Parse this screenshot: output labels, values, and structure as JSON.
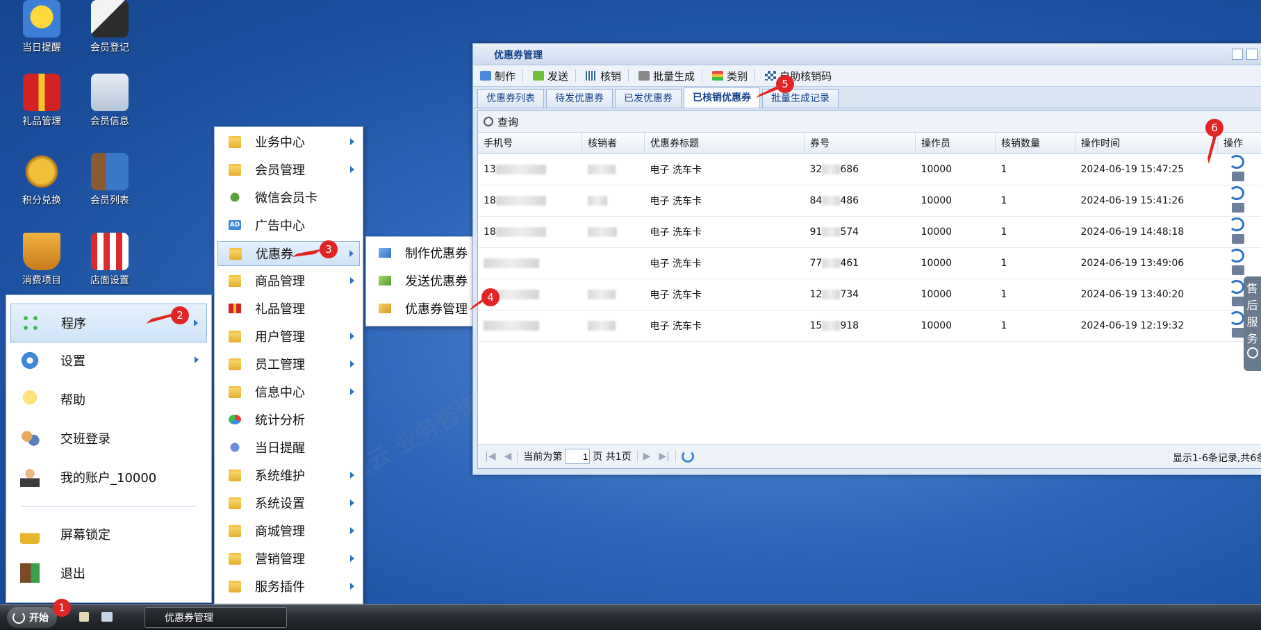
{
  "desktop": {
    "icons": [
      {
        "label": "当日提醒",
        "icon": "smiley-reminder-icon"
      },
      {
        "label": "会员登记",
        "icon": "member-register-icon"
      },
      {
        "label": "礼品管理",
        "icon": "gift-icon"
      },
      {
        "label": "会员信息",
        "icon": "member-info-icon"
      },
      {
        "label": "积分兑换",
        "icon": "points-exchange-icon"
      },
      {
        "label": "会员列表",
        "icon": "member-list-icon"
      },
      {
        "label": "消费项目",
        "icon": "basket-icon"
      },
      {
        "label": "店面设置",
        "icon": "store-icon"
      }
    ]
  },
  "start_menu": {
    "items": [
      {
        "label": "程序",
        "icon": "programs-icon"
      },
      {
        "label": "设置",
        "icon": "gear-icon"
      },
      {
        "label": "帮助",
        "icon": "lightbulb-icon"
      },
      {
        "label": "交班登录",
        "icon": "users-icon"
      },
      {
        "label": "我的账户_10000",
        "icon": "account-icon"
      },
      {
        "label": "屏幕锁定",
        "icon": "lock-icon"
      },
      {
        "label": "退出",
        "icon": "exit-icon"
      }
    ]
  },
  "programs_menu": {
    "items": [
      {
        "label": "业务中心"
      },
      {
        "label": "会员管理"
      },
      {
        "label": "微信会员卡"
      },
      {
        "label": "广告中心"
      },
      {
        "label": "优惠券"
      },
      {
        "label": "商品管理"
      },
      {
        "label": "礼品管理"
      },
      {
        "label": "用户管理"
      },
      {
        "label": "员工管理"
      },
      {
        "label": "信息中心"
      },
      {
        "label": "统计分析"
      },
      {
        "label": "当日提醒"
      },
      {
        "label": "系统维护"
      },
      {
        "label": "系统设置"
      },
      {
        "label": "商城管理"
      },
      {
        "label": "营销管理"
      },
      {
        "label": "服务插件"
      }
    ],
    "ad_label": "AD"
  },
  "coupon_menu": {
    "items": [
      {
        "label": "制作优惠券"
      },
      {
        "label": "发送优惠券"
      },
      {
        "label": "优惠券管理"
      }
    ]
  },
  "window": {
    "title": "优惠券管理",
    "toolbar": [
      "制作",
      "发送",
      "核销",
      "批量生成",
      "类别",
      "自助核销码"
    ],
    "tabs": [
      "优惠券列表",
      "待发优惠券",
      "已发优惠券",
      "已核销优惠券",
      "批量生成记录"
    ],
    "query_label": "查询",
    "columns": [
      "手机号",
      "核销者",
      "优惠券标题",
      "券号",
      "操作员",
      "核销数量",
      "操作时间",
      "操作"
    ],
    "rows": [
      {
        "phone": "13",
        "title": "电子 洗车卡",
        "no_a": "32",
        "no_b": "686",
        "operator": "10000",
        "qty": "1",
        "time": "2024-06-19 15:47:25"
      },
      {
        "phone": "18",
        "title": "电子 洗车卡",
        "no_a": "84",
        "no_b": "486",
        "operator": "10000",
        "qty": "1",
        "time": "2024-06-19 15:41:26"
      },
      {
        "phone": "18",
        "title": "电子 洗车卡",
        "no_a": "91",
        "no_b": "574",
        "operator": "10000",
        "qty": "1",
        "time": "2024-06-19 14:48:18"
      },
      {
        "phone": "",
        "title": "电子 洗车卡",
        "no_a": "77",
        "no_b": "461",
        "operator": "10000",
        "qty": "1",
        "time": "2024-06-19 13:49:06"
      },
      {
        "phone": "",
        "title": "电子 洗车卡",
        "no_a": "12",
        "no_b": "734",
        "operator": "10000",
        "qty": "1",
        "time": "2024-06-19 13:40:20"
      },
      {
        "phone": "",
        "title": "电子 洗车卡",
        "no_a": "15",
        "no_b": "918",
        "operator": "10000",
        "qty": "1",
        "time": "2024-06-19 12:19:32"
      }
    ],
    "pager": {
      "prefix": "当前为第",
      "page": "1",
      "suffix": "页 共1页",
      "summary": "显示1-6条记录,共6条"
    }
  },
  "side_tab": {
    "chars": [
      "售",
      "后",
      "服",
      "务"
    ]
  },
  "taskbar": {
    "start_label": "开始",
    "task_label": "优惠券管理"
  },
  "badges": [
    "1",
    "2",
    "3",
    "4",
    "5",
    "6"
  ],
  "watermark": "钱客多智慧云 业务咨询电话：18613772929 技术支持电话：18613772929"
}
